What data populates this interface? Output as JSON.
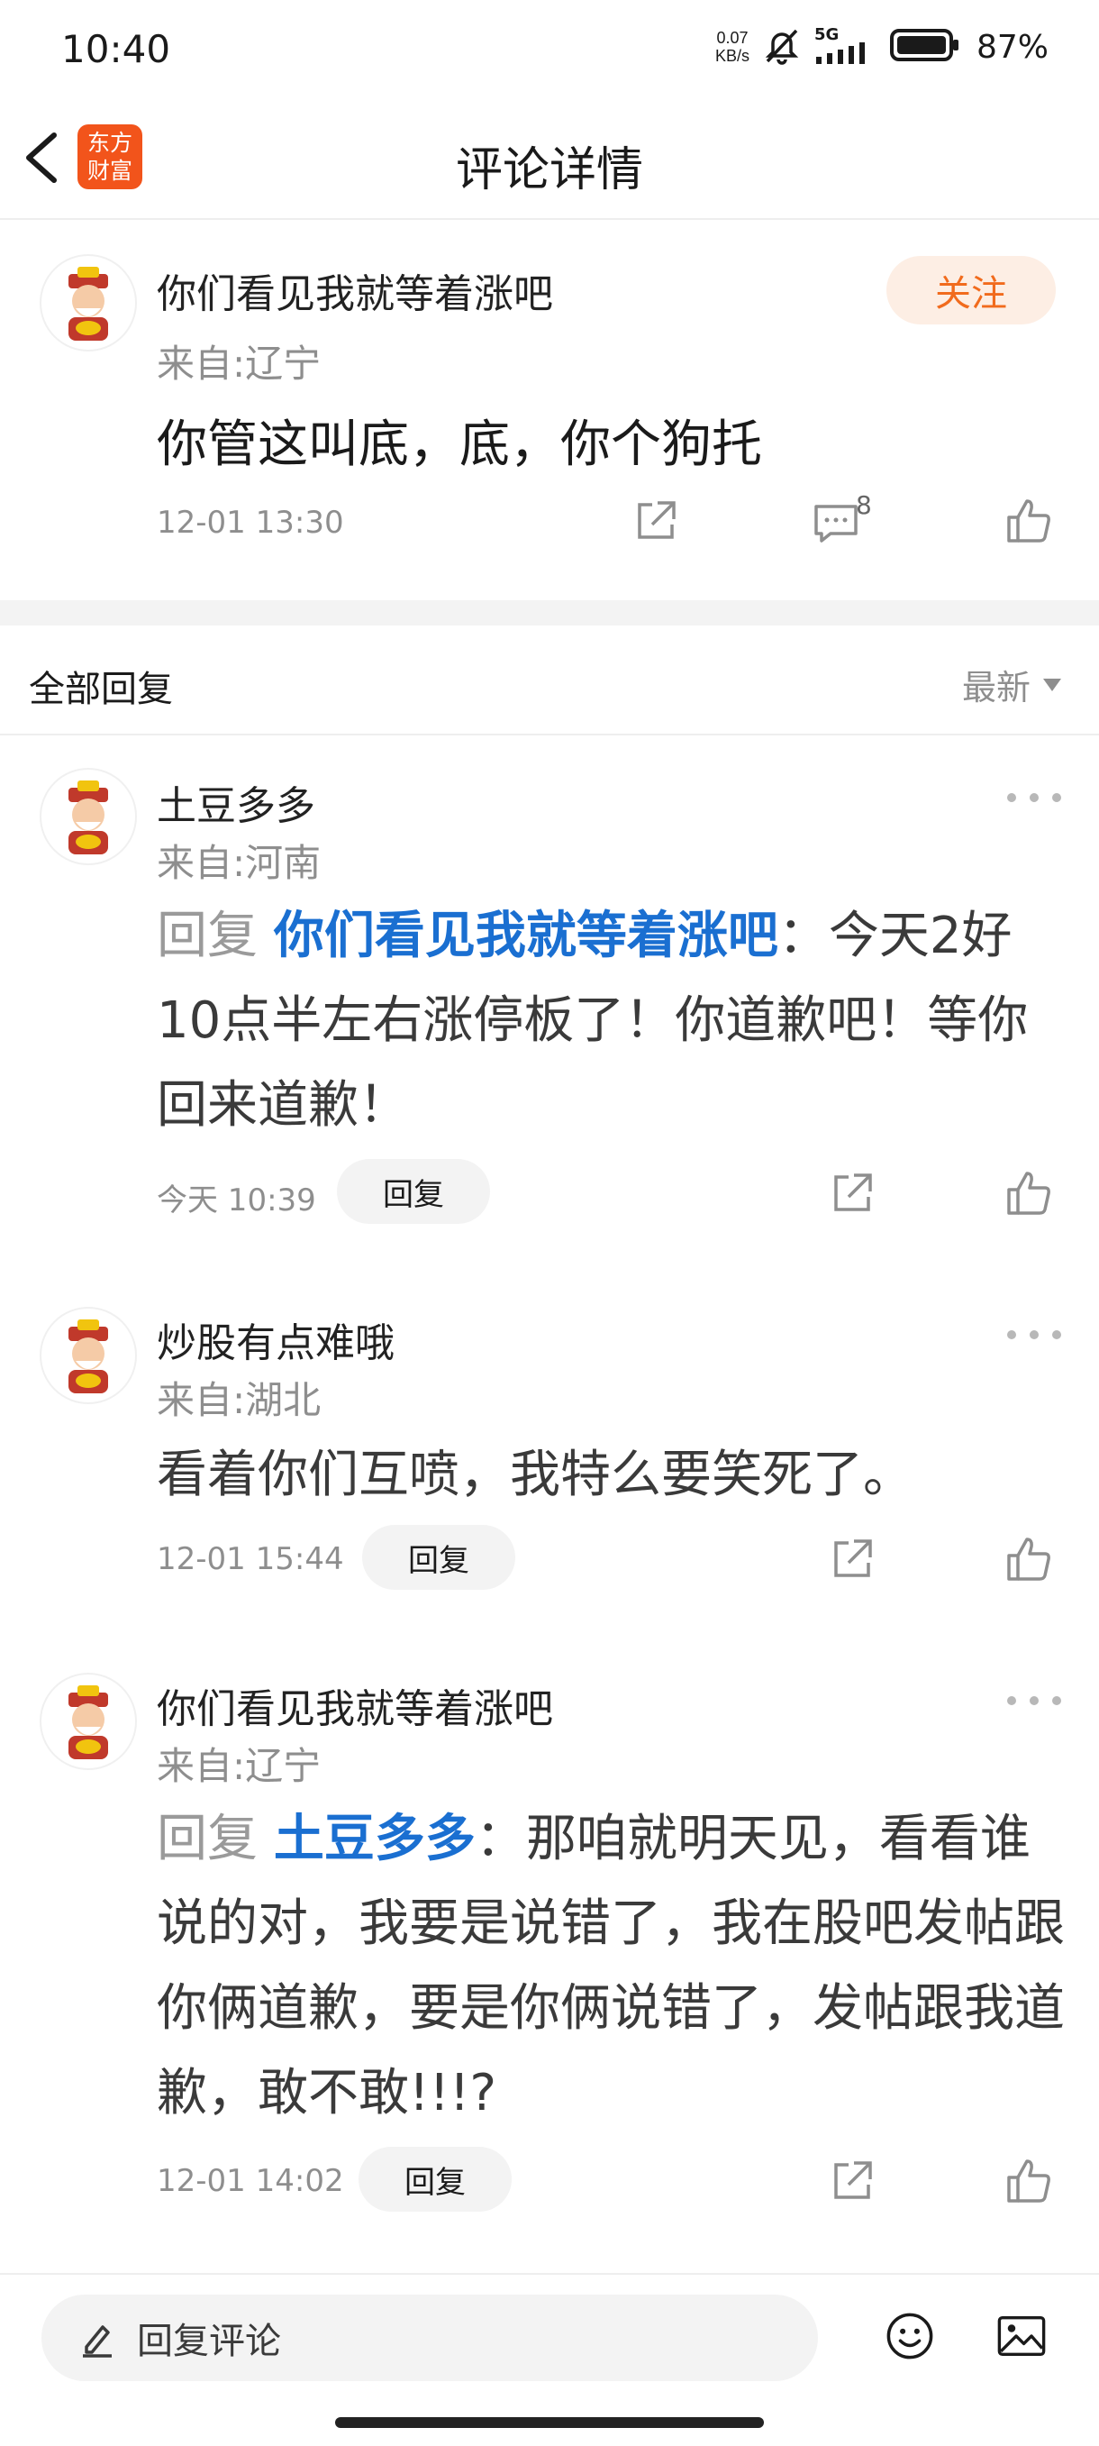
{
  "status_bar": {
    "time": "10:40",
    "net_speed_value": "0.07",
    "net_speed_unit": "KB/s",
    "network_label": "5G",
    "battery_pct": "87%"
  },
  "header": {
    "title": "评论详情",
    "logo_line1": "东方",
    "logo_line2": "财富"
  },
  "main_post": {
    "username": "你们看见我就等着涨吧",
    "location": "来自:辽宁",
    "text": "你管这叫底，底，你个狗托",
    "time": "12-01 13:30",
    "comment_count": "8",
    "follow_label": "关注"
  },
  "section": {
    "title": "全部回复",
    "sort_label": "最新"
  },
  "replies": [
    {
      "username": "土豆多多",
      "location": "来自:河南",
      "prefix": "回复 ",
      "mention": "你们看见我就等着涨吧",
      "text": "：今天2好10点半左右涨停板了！你道歉吧！等你回来道歉！",
      "time": "今天 10:39",
      "reply_label": "回复"
    },
    {
      "username": "炒股有点难哦",
      "location": "来自:湖北",
      "text": "看着你们互喷，我特么要笑死了。",
      "time": "12-01 15:44",
      "reply_label": "回复"
    },
    {
      "username": "你们看见我就等着涨吧",
      "location": "来自:辽宁",
      "prefix": "回复 ",
      "mention": "土豆多多",
      "text": "：那咱就明天见，看看谁说的对，我要是说错了，我在股吧发帖跟你俩道歉，要是你俩说错了，发帖跟我道歉，敢不敢!!!?",
      "time": "12-01 14:02",
      "reply_label": "回复"
    }
  ],
  "bottom_bar": {
    "input_placeholder": "回复评论"
  }
}
